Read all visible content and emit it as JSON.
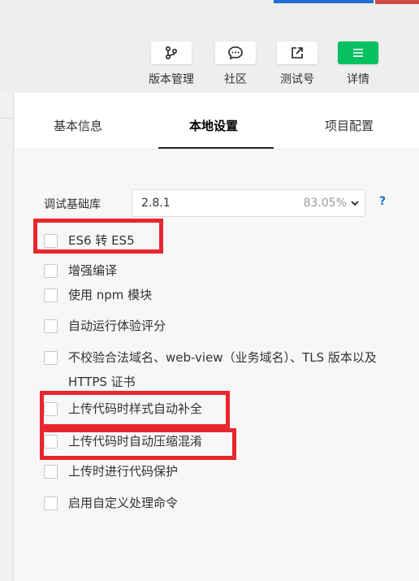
{
  "toolbar": {
    "version_mgmt": "版本管理",
    "community": "社区",
    "test_number": "测试号",
    "details": "详情"
  },
  "tabs": {
    "basic_info": "基本信息",
    "local_settings": "本地设置",
    "project_config": "项目配置"
  },
  "settings": {
    "base_lib_label": "调试基础库",
    "base_lib_value": "2.8.1",
    "base_lib_percent": "83.05%",
    "help": "?",
    "options": [
      {
        "label": "ES6 转 ES5",
        "checked": false
      },
      {
        "label": "增强编译",
        "checked": false
      },
      {
        "label": "使用 npm 模块",
        "checked": false
      },
      {
        "label": "自动运行体验评分",
        "checked": false
      },
      {
        "label": "不校验合法域名、web-view（业务域名）、TLS 版本以及 HTTPS 证书",
        "checked": false
      },
      {
        "label": "上传代码时样式自动补全",
        "checked": false
      },
      {
        "label": "上传代码时自动压缩混淆",
        "checked": false
      },
      {
        "label": "上传时进行代码保护",
        "checked": false
      },
      {
        "label": "启用自定义处理命令",
        "checked": false
      }
    ]
  },
  "colors": {
    "accent_green": "#07c160",
    "highlight_red": "#e8262d",
    "help_blue": "#1a6fdc"
  }
}
